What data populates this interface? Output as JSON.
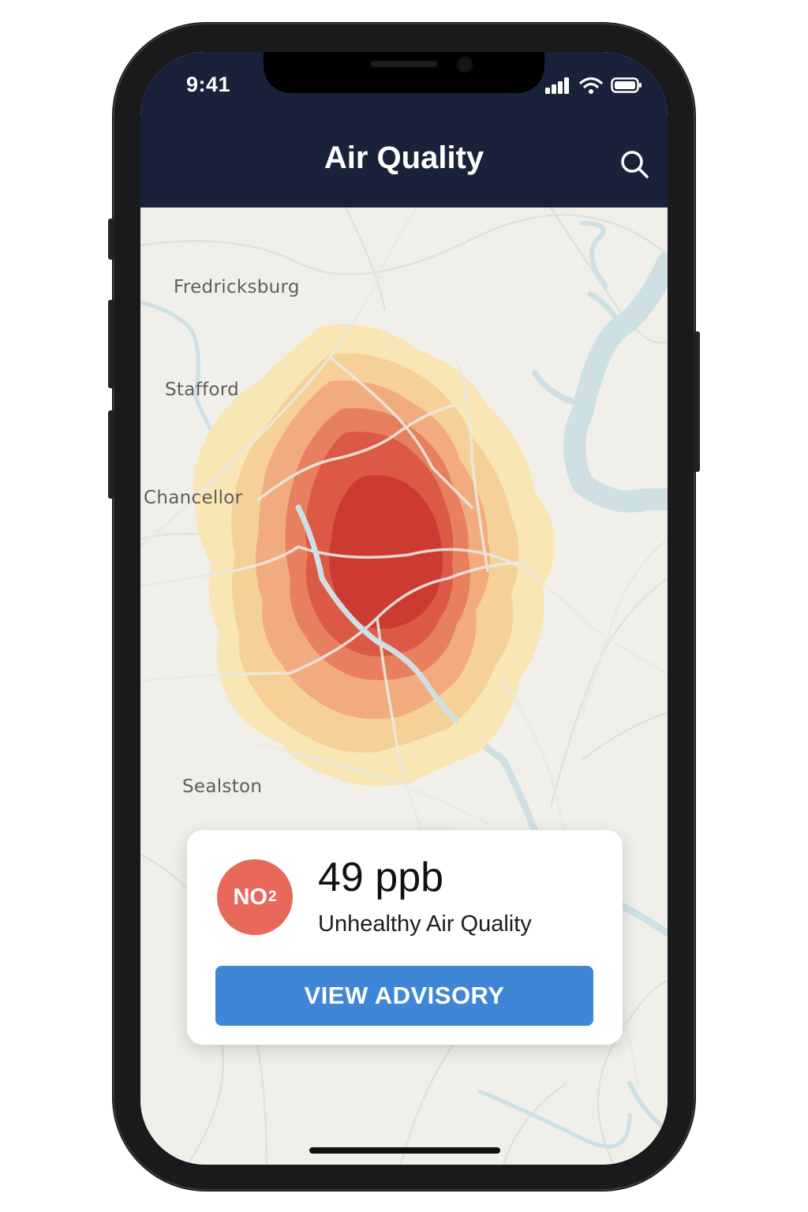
{
  "status_bar": {
    "time": "9:41"
  },
  "header": {
    "title": "Air Quality",
    "search_icon": "search-icon"
  },
  "map": {
    "labels": {
      "fredricksburg": "Fredricksburg",
      "stafford": "Stafford",
      "chancellor": "Chancellor",
      "sealston": "Sealston"
    }
  },
  "reading_card": {
    "pollutant_main": "NO",
    "pollutant_sub": "2",
    "value": "49 ppb",
    "quality": "Unhealthy Air Quality",
    "button_label": "VIEW ADVISORY"
  },
  "colors": {
    "header_bg": "#19223a",
    "badge": "#e8685c",
    "button": "#3f86d6",
    "map_bg": "#f1efea",
    "water": "#cfe0e5",
    "heat_high": "#cc3a32",
    "heat_low": "#f6dfa8"
  }
}
